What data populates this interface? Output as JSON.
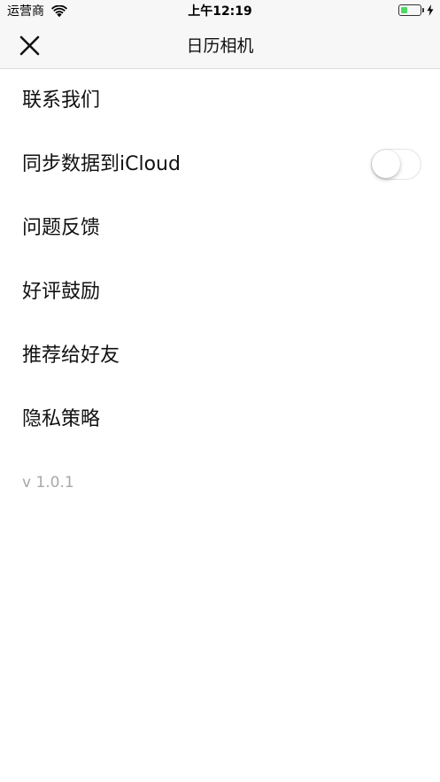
{
  "status_bar": {
    "carrier": "运营商",
    "time": "上午12:19",
    "battery_level": 0.35,
    "charging": true,
    "icons": [
      "wifi-icon",
      "battery-icon",
      "charging-bolt-icon"
    ]
  },
  "nav": {
    "title": "日历相机",
    "close_icon": "close-icon"
  },
  "menu": {
    "items": [
      {
        "label": "联系我们"
      },
      {
        "label": "同步数据到iCloud",
        "toggle_on": false
      },
      {
        "label": "问题反馈"
      },
      {
        "label": "好评鼓励"
      },
      {
        "label": "推荐给好友"
      },
      {
        "label": "隐私策略"
      }
    ]
  },
  "version": "v 1.0.1",
  "colors": {
    "nav_background": "#f7f7f7",
    "battery_fill": "#4cd964",
    "version_text": "#a8a8a8",
    "divider": "#dcdcdc"
  }
}
